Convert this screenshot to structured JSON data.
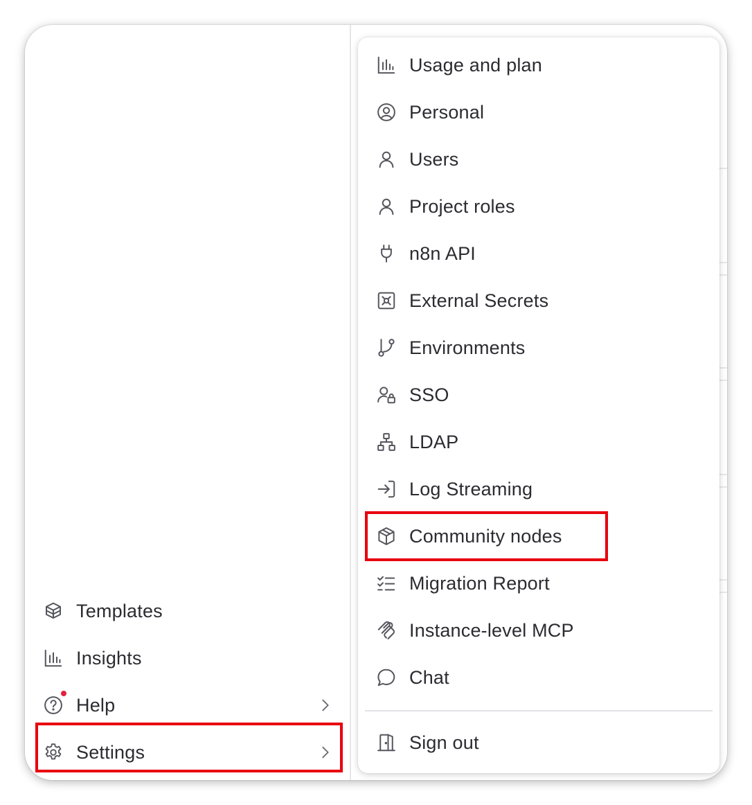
{
  "sidebar": {
    "items": [
      {
        "label": "Templates",
        "icon": "templates-box-icon",
        "has_chevron": false
      },
      {
        "label": "Insights",
        "icon": "bar-chart-icon",
        "has_chevron": false
      },
      {
        "label": "Help",
        "icon": "question-circle-icon",
        "has_chevron": true,
        "badge": "notification-dot"
      },
      {
        "label": "Settings",
        "icon": "gear-icon",
        "has_chevron": true,
        "highlighted": true
      }
    ]
  },
  "settings_menu": {
    "items": [
      {
        "label": "Usage and plan",
        "icon": "bar-chart-icon"
      },
      {
        "label": "Personal",
        "icon": "user-circle-icon"
      },
      {
        "label": "Users",
        "icon": "user-icon"
      },
      {
        "label": "Project roles",
        "icon": "user-icon"
      },
      {
        "label": "n8n API",
        "icon": "plug-icon"
      },
      {
        "label": "External Secrets",
        "icon": "vault-icon"
      },
      {
        "label": "Environments",
        "icon": "git-branch-icon"
      },
      {
        "label": "SSO",
        "icon": "user-lock-icon"
      },
      {
        "label": "LDAP",
        "icon": "network-icon"
      },
      {
        "label": "Log Streaming",
        "icon": "log-in-icon"
      },
      {
        "label": "Community nodes",
        "icon": "box-icon",
        "highlighted": true
      },
      {
        "label": "Migration Report",
        "icon": "list-checks-icon"
      },
      {
        "label": "Instance-level MCP",
        "icon": "mcp-icon"
      },
      {
        "label": "Chat",
        "icon": "chat-bubble-icon"
      }
    ],
    "sign_out": {
      "label": "Sign out",
      "icon": "door-exit-icon"
    }
  },
  "colors": {
    "highlight": "#e8000e",
    "notification_dot": "#e2233d",
    "text": "#2b2b31",
    "icon": "#55555d"
  }
}
